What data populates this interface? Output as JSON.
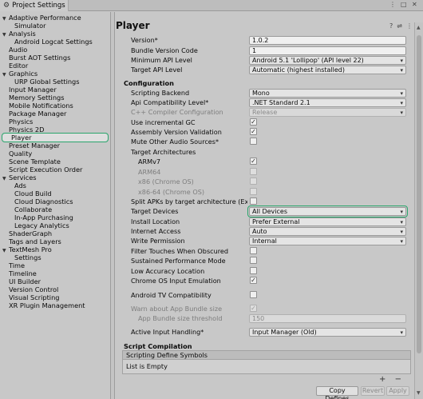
{
  "window": {
    "title": "Project Settings",
    "controls": [
      "⋮",
      "□",
      "✕"
    ]
  },
  "sidebar": {
    "items": [
      {
        "label": "Adaptive Performance",
        "expanded": true
      },
      {
        "label": "Simulator",
        "indent": true
      },
      {
        "label": "Analysis",
        "expanded": true
      },
      {
        "label": "Android Logcat Settings",
        "indent": true
      },
      {
        "label": "Audio"
      },
      {
        "label": "Burst AOT Settings"
      },
      {
        "label": "Editor"
      },
      {
        "label": "Graphics",
        "expanded": true
      },
      {
        "label": "URP Global Settings",
        "indent": true
      },
      {
        "label": "Input Manager"
      },
      {
        "label": "Memory Settings"
      },
      {
        "label": "Mobile Notifications"
      },
      {
        "label": "Package Manager"
      },
      {
        "label": "Physics"
      },
      {
        "label": "Physics 2D"
      },
      {
        "label": "Player",
        "selected": true
      },
      {
        "label": "Preset Manager"
      },
      {
        "label": "Quality"
      },
      {
        "label": "Scene Template"
      },
      {
        "label": "Script Execution Order"
      },
      {
        "label": "Services",
        "expanded": true
      },
      {
        "label": "Ads",
        "indent": true
      },
      {
        "label": "Cloud Build",
        "indent": true
      },
      {
        "label": "Cloud Diagnostics",
        "indent": true
      },
      {
        "label": "Collaborate",
        "indent": true
      },
      {
        "label": "In-App Purchasing",
        "indent": true
      },
      {
        "label": "Legacy Analytics",
        "indent": true
      },
      {
        "label": "ShaderGraph"
      },
      {
        "label": "Tags and Layers"
      },
      {
        "label": "TextMesh Pro",
        "expanded": true
      },
      {
        "label": "Settings",
        "indent": true
      },
      {
        "label": "Time"
      },
      {
        "label": "Timeline"
      },
      {
        "label": "UI Builder"
      },
      {
        "label": "Version Control"
      },
      {
        "label": "Visual Scripting"
      },
      {
        "label": "XR Plugin Management"
      }
    ]
  },
  "main": {
    "title": "Player",
    "header_icons": [
      "help-icon",
      "sliders-icon",
      "kebab-menu-icon"
    ],
    "identification": {
      "version_label": "Version*",
      "version_value": "1.0.2",
      "bundle_code_label": "Bundle Version Code",
      "bundle_code_value": "1",
      "min_api_label": "Minimum API Level",
      "min_api_value": "Android 5.1 'Lollipop' (API level 22)",
      "target_api_label": "Target API Level",
      "target_api_value": "Automatic (highest installed)"
    },
    "configuration": {
      "heading": "Configuration",
      "scripting_backend_label": "Scripting Backend",
      "scripting_backend_value": "Mono",
      "api_compat_label": "Api Compatibility Level*",
      "api_compat_value": ".NET Standard 2.1",
      "cpp_config_label": "C++ Compiler Configuration",
      "cpp_config_value": "Release",
      "incremental_gc_label": "Use incremental GC",
      "incremental_gc_checked": true,
      "assembly_validation_label": "Assembly Version Validation",
      "assembly_validation_checked": true,
      "mute_audio_label": "Mute Other Audio Sources*",
      "mute_audio_checked": false,
      "target_arch_label": "Target Architectures",
      "armv7_label": "ARMv7",
      "armv7_checked": true,
      "arm64_label": "ARM64",
      "arm64_checked": false,
      "x86_label": "x86 (Chrome OS)",
      "x86_checked": false,
      "x86_64_label": "x86-64 (Chrome OS)",
      "x86_64_checked": false,
      "split_apks_label": "Split APKs by target architecture (Experime",
      "split_apks_checked": false,
      "target_devices_label": "Target Devices",
      "target_devices_value": "All Devices",
      "install_location_label": "Install Location",
      "install_location_value": "Prefer External",
      "internet_access_label": "Internet Access",
      "internet_access_value": "Auto",
      "write_permission_label": "Write Permission",
      "write_permission_value": "Internal",
      "filter_touches_label": "Filter Touches When Obscured",
      "filter_touches_checked": false,
      "sustained_perf_label": "Sustained Performance Mode",
      "sustained_perf_checked": false,
      "low_accuracy_label": "Low Accuracy Location",
      "low_accuracy_checked": false,
      "chrome_os_label": "Chrome OS Input Emulation",
      "chrome_os_checked": true,
      "android_tv_label": "Android TV Compatibility",
      "android_tv_checked": false,
      "warn_bundle_label": "Warn about App Bundle size",
      "warn_bundle_checked": true,
      "bundle_threshold_label": "App Bundle size threshold",
      "bundle_threshold_value": "150",
      "active_input_label": "Active Input Handling*",
      "active_input_value": "Input Manager (Old)"
    },
    "script_compilation": {
      "heading": "Script Compilation",
      "defines_header": "Scripting Define Symbols",
      "list_empty": "List is Empty",
      "plus": "+",
      "minus": "−"
    },
    "buttons": {
      "copy_defines": "Copy Defines",
      "revert": "Revert",
      "apply": "Apply"
    }
  },
  "colors": {
    "selection_outline": "#2aa56c",
    "background": "#c8c8c8"
  }
}
